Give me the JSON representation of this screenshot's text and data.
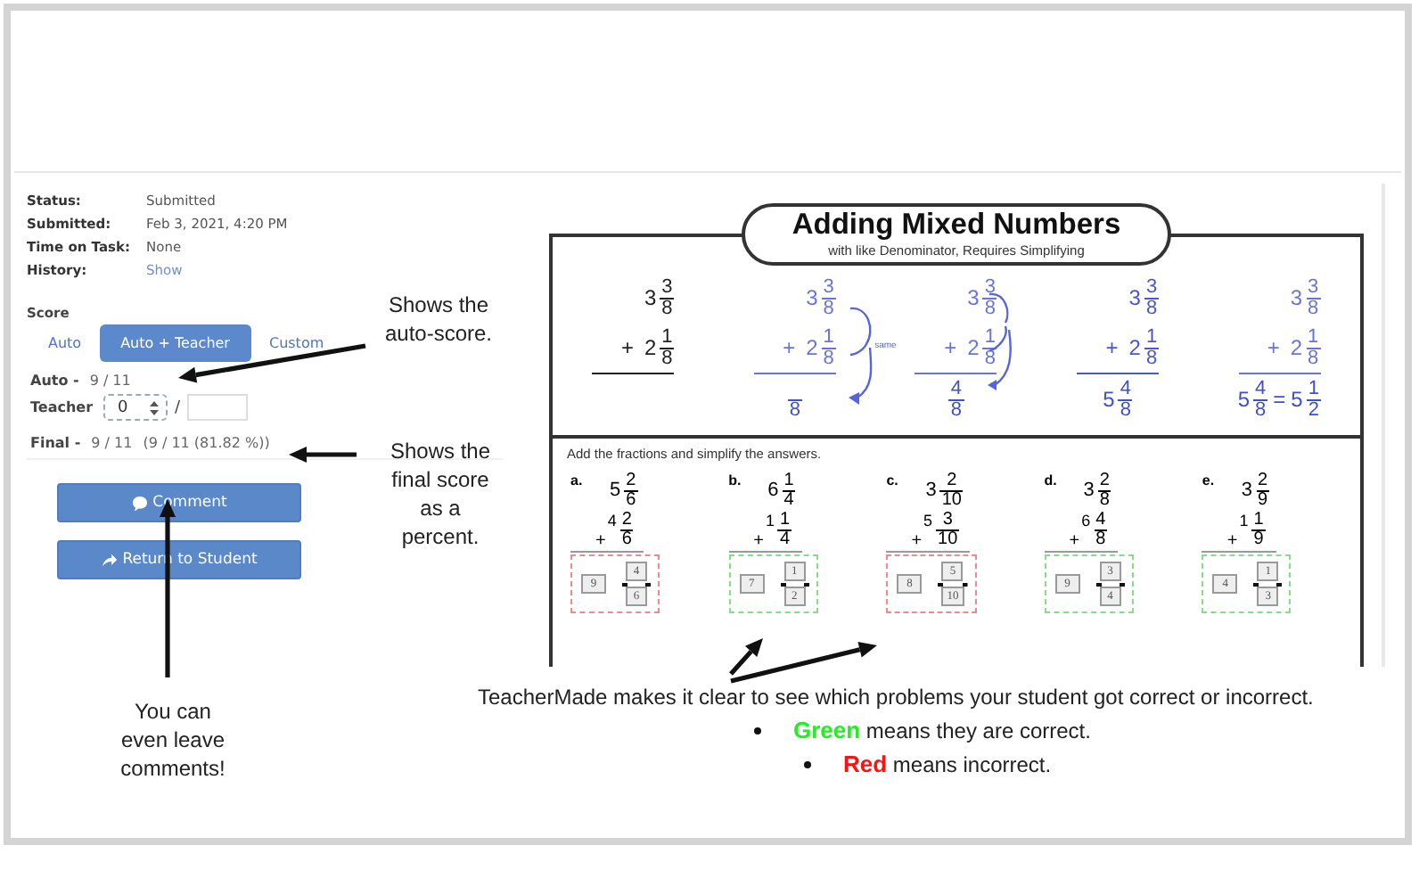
{
  "status": [
    {
      "label": "Status:",
      "value": "Submitted",
      "kind": "text"
    },
    {
      "label": "Submitted:",
      "value": "Feb 3, 2021, 4:20 PM",
      "kind": "text"
    },
    {
      "label": "Time on Task:",
      "value": "None",
      "kind": "text"
    },
    {
      "label": "History:",
      "value": "Show",
      "kind": "link"
    }
  ],
  "score": {
    "heading": "Score",
    "tabs": [
      {
        "label": "Auto",
        "selected": false
      },
      {
        "label": "Auto + Teacher",
        "selected": true
      },
      {
        "label": "Custom",
        "selected": false
      }
    ],
    "auto": {
      "label": "Auto -",
      "value": "9 / 11"
    },
    "teacher": {
      "label": "Teacher",
      "value": "0",
      "separator": "/"
    },
    "final": {
      "label": "Final -",
      "value": "9 / 11",
      "detail": "(9 / 11 (81.82 %))"
    }
  },
  "buttons": [
    {
      "label": "Comment",
      "kind": "comment"
    },
    {
      "label": "Return to Student",
      "kind": "return"
    }
  ],
  "worksheet": {
    "title": "Adding Mixed Numbers",
    "subtitle": "with like Denominator, Requires Simplifying",
    "example_steps": [
      {
        "kind": "given",
        "top": {
          "whole": "3",
          "num": "3",
          "den": "8"
        },
        "sign": "+",
        "bottom": {
          "whole": "2",
          "num": "1",
          "den": "8"
        }
      },
      {
        "kind": "denominator",
        "top": {
          "whole": "3",
          "num": "3",
          "den": "8"
        },
        "sign": "+",
        "bottom": {
          "whole": "2",
          "num": "1",
          "den": "8"
        },
        "note": "same",
        "answer": [
          {
            "kind": "mixed",
            "den": "8"
          }
        ]
      },
      {
        "kind": "numerator",
        "top": {
          "whole": "3",
          "num": "3",
          "den": "8"
        },
        "sign": "+",
        "bottom": {
          "whole": "2",
          "num": "1",
          "den": "8"
        },
        "answer": [
          {
            "kind": "mixed",
            "num": "4",
            "den": "8"
          }
        ]
      },
      {
        "kind": "wholes",
        "top": {
          "whole": "3",
          "num": "3",
          "den": "8"
        },
        "sign": "+",
        "bottom": {
          "whole": "2",
          "num": "1",
          "den": "8"
        },
        "answer": [
          {
            "kind": "mixed",
            "whole": "5",
            "num": "4",
            "den": "8"
          }
        ]
      },
      {
        "kind": "simplify",
        "top": {
          "whole": "3",
          "num": "3",
          "den": "8"
        },
        "sign": "+",
        "bottom": {
          "whole": "2",
          "num": "1",
          "den": "8"
        },
        "answer": [
          {
            "kind": "mixed",
            "whole": "5",
            "num": "4",
            "den": "8"
          },
          {
            "kind": "sign",
            "text": "="
          },
          {
            "kind": "mixed",
            "whole": "5",
            "num": "1",
            "den": "2"
          }
        ]
      }
    ],
    "instruction": "Add the fractions and simplify the answers.",
    "problems": [
      {
        "label": "a.",
        "top": {
          "whole": "5",
          "num": "2",
          "den": "6"
        },
        "sign": "+",
        "bottom": {
          "whole": "4",
          "num": "2",
          "den": "6"
        },
        "answer": {
          "whole": "9",
          "num": "4",
          "den": "6"
        },
        "correct": false
      },
      {
        "label": "b.",
        "top": {
          "whole": "6",
          "num": "1",
          "den": "4"
        },
        "sign": "+",
        "bottom": {
          "whole": "1",
          "num": "1",
          "den": "4"
        },
        "answer": {
          "whole": "7",
          "num": "1",
          "den": "2"
        },
        "correct": true
      },
      {
        "label": "c.",
        "top": {
          "whole": "3",
          "num": "2",
          "den": "10"
        },
        "sign": "+",
        "bottom": {
          "whole": "5",
          "num": "3",
          "den": "10"
        },
        "answer": {
          "whole": "8",
          "num": "5",
          "den": "10"
        },
        "correct": false
      },
      {
        "label": "d.",
        "top": {
          "whole": "3",
          "num": "2",
          "den": "8"
        },
        "sign": "+",
        "bottom": {
          "whole": "6",
          "num": "4",
          "den": "8"
        },
        "answer": {
          "whole": "9",
          "num": "3",
          "den": "4"
        },
        "correct": true
      },
      {
        "label": "e.",
        "top": {
          "whole": "3",
          "num": "2",
          "den": "9"
        },
        "sign": "+",
        "bottom": {
          "whole": "1",
          "num": "1",
          "den": "9"
        },
        "answer": {
          "whole": "4",
          "num": "1",
          "den": "3"
        },
        "correct": true
      }
    ]
  },
  "callouts": [
    {
      "kind": "auto",
      "text": "Shows the auto-score."
    },
    {
      "kind": "final",
      "text": "Shows the final score as a percent."
    },
    {
      "kind": "comment",
      "text": "You can even leave comments!"
    }
  ],
  "caption": "TeacherMade makes it clear to see which problems your student got correct or incorrect.",
  "legend": [
    {
      "term": "Green",
      "text": "means they are correct.",
      "color": "#22ee22"
    },
    {
      "term": "Red",
      "text": "means incorrect.",
      "color": "#ff1111"
    }
  ]
}
